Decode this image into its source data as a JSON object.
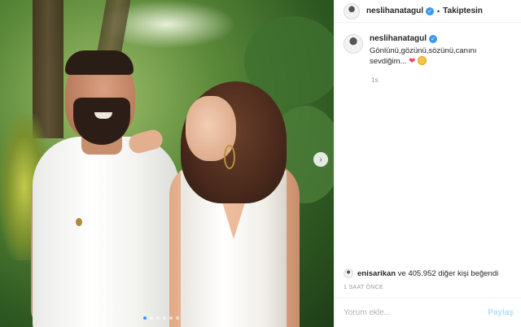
{
  "post": {
    "username": "neslihanatagul",
    "follow_status": "Takiptesin",
    "separator": "•",
    "caption": "Gönlünü,gözünü,sözünü,canını sevdiğim...",
    "time_short": "1s",
    "likes_user": "enisarikan",
    "likes_rest": "ve 405.952 diğer kişi beğendi",
    "time_ago": "1 SAAT ÖNCE"
  },
  "comment": {
    "placeholder": "Yorum ekle...",
    "share_label": "Paylaş"
  },
  "carousel": {
    "next_icon": "chevron-right-icon",
    "total_slides": 6,
    "active_slide": 1
  },
  "colors": {
    "verified": "#3897f0",
    "heart": "#ed4956",
    "share_disabled": "#b2dffc"
  }
}
